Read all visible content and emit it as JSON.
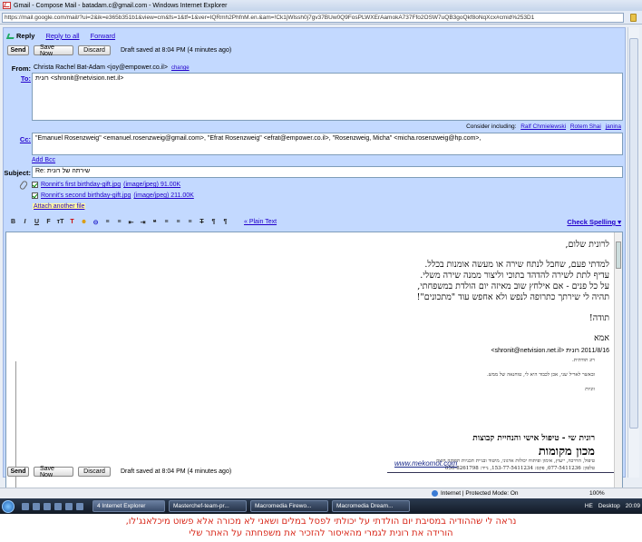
{
  "window": {
    "title": "Gmail - Compose Mail - batadam.c@gmail.com - Windows Internet Explorer",
    "url": "https://mail.google.com/mail/?ui=2&ik=e365b351b1&view=cm&fs=1&tf=1&ver=IQRmh2PhfnM.en.&am=!Ck1jWlssh0j7gv37BUw0Q9FosPLWXErAamokA737Ffo2OSW7uQB3goQkf8oNqXcx#cmid%253D1"
  },
  "actions": {
    "reply": "Reply",
    "reply_all": "Reply to all",
    "forward": "Forward"
  },
  "toolbar": {
    "send": "Send",
    "save": "Save Now",
    "discard": "Discard",
    "draft_status": "Draft saved at 8:04 PM (4 minutes ago)"
  },
  "from": {
    "label": "From:",
    "value": "Christa Rachel Bat-Adam <joy@empower.co.il>",
    "change": "change"
  },
  "to": {
    "label": "To:",
    "value": "רונית <shronit@netvision.net.il>"
  },
  "consider": {
    "prefix": "Consider including:",
    "names": [
      "Ralf Chmielewski",
      "Rotem Shai",
      "janina"
    ]
  },
  "cc": {
    "label": "Cc:",
    "value": "\"Emanuel Rosenzweig\" <emanuel.rosenzweig@gmail.com>, \"Efrat Rosenzweig\" <efrat@empower.co.il>, \"Rosenzweig, Micha\" <micha.rosenzweig@hp.com>,"
  },
  "add_bcc": "Add Bcc",
  "subject": {
    "label": "Subject:",
    "value": "Re: שירתה של רונית"
  },
  "attachments": [
    {
      "name": "Ronnit's first birthday-gift.jpg",
      "meta": "(image/jpeg) 91.00K"
    },
    {
      "name": "Ronnit's second birthday-gift.jpg",
      "meta": "(image/jpeg) 211.00K"
    }
  ],
  "attach_another": "Attach another file",
  "format": {
    "buttons": [
      "B",
      "I",
      "U",
      "F",
      "тT",
      "T",
      "☻",
      "⊝",
      "≡",
      "≡",
      "⇤",
      "⇥",
      "❝",
      "≡",
      "≡",
      "≡",
      "T",
      "¶",
      "¶"
    ],
    "plain_text": "« Plain Text",
    "check_spelling": "Check Spelling ▾"
  },
  "message": {
    "greeting": "לרונית שלום,",
    "lines": [
      "למדתי פעם, שחבל לנתח שירה או מעשה אומנות בכלל.",
      "עדיף לתת לשירה להדהד בתוכי וליצור ממנה שירה משלי.",
      "על כל פנים - אם אילחץ שוב מאיזה יום הולדת במשפחתי,",
      "תהיה לי שירתך כתרופה לנפש ולא אחפש עוד \"מתכונים\"!"
    ],
    "thanks": "תודה!",
    "signoff": "אמא"
  },
  "quote": {
    "header": "2011/8/16 רונית <shronit@netvision.net.il>",
    "l1": "רונ תודתית.",
    "l2": "ובאשר לאריל שני, אכן לכבוד היא לי, טוחנאה של ממש.",
    "l3": "ווניות",
    "sig_line1": "רונית שי - טיפול אישי והנחיית קבוצות",
    "sig_line2": "מכון מקומות",
    "sig_small1": "טיפול, הדרכה, ייעוץ, אימון ופיתוח יכולות ארגוני, מיטוד ובניית תכניות תפוקה חוצה",
    "sig_small2": "טלפון: 077-5411236, פקס: 153-77-5411234, נייד: 050-8261798",
    "website": "www.mekomot.com"
  },
  "statusbar": {
    "zone": "Internet | Protected Mode: On",
    "zoom": "100%"
  },
  "taskbar": {
    "tasks": [
      "4 Internet Explorer",
      "Masterchef-team-pr...",
      "Macromedia Firewo...",
      "Macromedia Dream..."
    ],
    "lang": "HE",
    "desktop": "Desktop",
    "time": "20:09"
  },
  "caption": {
    "line1": "נראה לי שההודיה במסיבת יום הולדתי על יכולתי לפסל במלים ושאני לא מכורה אלא פשוט מיכלאנג'לו,",
    "line2": "הורידה את רונית לגמרי מהאיסור להזכיר את משפחתה על האתר שלי"
  }
}
